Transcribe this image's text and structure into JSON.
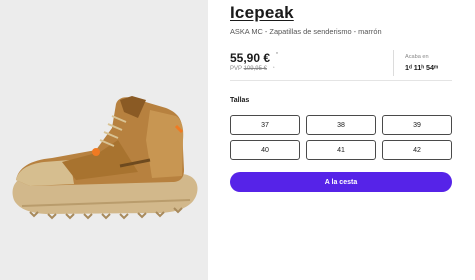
{
  "product": {
    "brand": "Icepeak",
    "subtitle": "ASKA MC - Zapatillas de senderismo - marrón",
    "image": {
      "name": "shoe-image",
      "description_colors": {
        "main": "#b98443",
        "sole": "#cfb487",
        "accent": "#f07a22"
      }
    }
  },
  "price": {
    "current": "55,90 €",
    "current_sup": "*",
    "pvp_label": "PVP",
    "pvp_old": "109,95 €",
    "pvp_sup": "*"
  },
  "countdown": {
    "label": "Acaba en",
    "time": "1ᵈ 11ʰ 54ᵐ"
  },
  "sizes": {
    "label": "Tallas",
    "options": [
      "37",
      "38",
      "39",
      "40",
      "41",
      "42"
    ]
  },
  "cart": {
    "label": "A la cesta"
  },
  "colors": {
    "accent": "#5623e8",
    "background_image": "#ececec"
  }
}
